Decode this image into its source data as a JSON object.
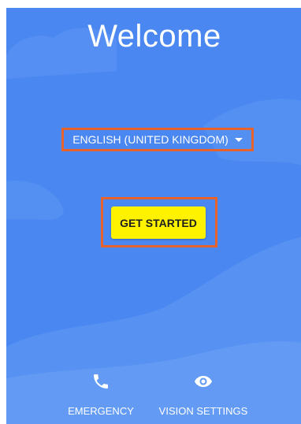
{
  "screen": {
    "background_color": "#4a87f0",
    "highlight_color": "#e8632b"
  },
  "title": "Welcome",
  "language_selector": {
    "label": "ENGLISH (UNITED KINGDOM)",
    "icon": "caret-down-icon"
  },
  "start_button": {
    "label": "GET STARTED",
    "color": "#fff200"
  },
  "bottom_actions": [
    {
      "label": "EMERGENCY",
      "icon": "phone-icon"
    },
    {
      "label": "VISION SETTINGS",
      "icon": "eye-icon"
    }
  ]
}
